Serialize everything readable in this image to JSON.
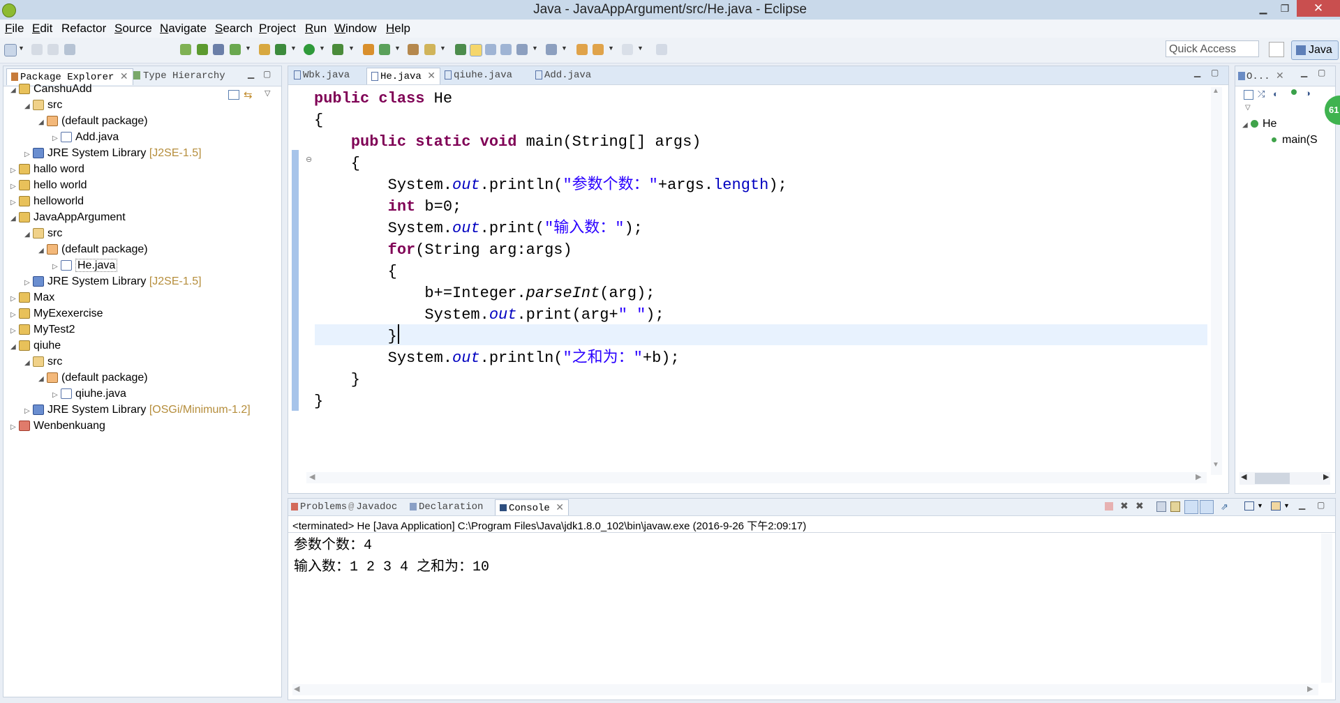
{
  "window": {
    "title": "Java - JavaAppArgument/src/He.java - Eclipse",
    "minimize": "▁",
    "maximize": "❐",
    "close": "✕"
  },
  "menu": [
    {
      "u": "F",
      "rest": "ile"
    },
    {
      "u": "E",
      "rest": "dit"
    },
    {
      "u": "",
      "rest": "Refactor"
    },
    {
      "u": "S",
      "rest": "ource"
    },
    {
      "u": "N",
      "rest": "avigate"
    },
    {
      "u": "S",
      "rest": "earch"
    },
    {
      "u": "P",
      "rest": "roject"
    },
    {
      "u": "R",
      "rest": "un"
    },
    {
      "u": "W",
      "rest": "indow"
    },
    {
      "u": "H",
      "rest": "elp"
    }
  ],
  "quick_access": {
    "placeholder": "Quick Access"
  },
  "perspective": {
    "label": "Java"
  },
  "package_explorer": {
    "tab_label": "Package Explorer",
    "tab2_label": "Type Hierarchy",
    "tree": [
      {
        "label": "CanshuAdd",
        "level": 0,
        "icon": "project-icon",
        "expanded": true
      },
      {
        "label": "src",
        "level": 1,
        "icon": "source-folder-icon",
        "expanded": true
      },
      {
        "label": "(default package)",
        "level": 2,
        "icon": "package-icon",
        "expanded": true
      },
      {
        "label": "Add.java",
        "level": 3,
        "icon": "java-file-icon",
        "expanded": false
      },
      {
        "label": "JRE System Library",
        "suffix": "[J2SE-1.5]",
        "level": 1,
        "icon": "jre-library-icon",
        "expanded": false
      },
      {
        "label": "hallo word",
        "level": 0,
        "icon": "project-icon",
        "expanded": false
      },
      {
        "label": "hello world",
        "level": 0,
        "icon": "project-icon",
        "expanded": false
      },
      {
        "label": "helloworld",
        "level": 0,
        "icon": "project-icon",
        "expanded": false
      },
      {
        "label": "JavaAppArgument",
        "level": 0,
        "icon": "project-icon",
        "expanded": true
      },
      {
        "label": "src",
        "level": 1,
        "icon": "source-folder-icon",
        "expanded": true
      },
      {
        "label": "(default package)",
        "level": 2,
        "icon": "package-icon",
        "expanded": true
      },
      {
        "label": "He.java",
        "level": 3,
        "icon": "java-file-icon",
        "expanded": false,
        "selected": true
      },
      {
        "label": "JRE System Library",
        "suffix": "[J2SE-1.5]",
        "level": 1,
        "icon": "jre-library-icon",
        "expanded": false
      },
      {
        "label": "Max",
        "level": 0,
        "icon": "project-icon",
        "expanded": false
      },
      {
        "label": "MyExexercise",
        "level": 0,
        "icon": "project-icon",
        "expanded": false
      },
      {
        "label": "MyTest2",
        "level": 0,
        "icon": "project-icon",
        "expanded": false
      },
      {
        "label": "qiuhe",
        "level": 0,
        "icon": "project-icon",
        "expanded": true
      },
      {
        "label": "src",
        "level": 1,
        "icon": "source-folder-icon",
        "expanded": true
      },
      {
        "label": "(default package)",
        "level": 2,
        "icon": "package-icon",
        "expanded": true
      },
      {
        "label": "qiuhe.java",
        "level": 3,
        "icon": "java-file-icon",
        "expanded": false
      },
      {
        "label": "JRE System Library",
        "suffix": "[OSGi/Minimum-1.2]",
        "level": 1,
        "icon": "jre-library-icon",
        "expanded": false
      },
      {
        "label": "Wenbenkuang",
        "level": 0,
        "icon": "project-error-icon",
        "expanded": false
      }
    ]
  },
  "editor": {
    "tabs": [
      "Wbk.java",
      "He.java",
      "qiuhe.java",
      "Add.java"
    ],
    "active_tab": "He.java"
  },
  "outline": {
    "tab_label": "O...",
    "class_label": "He",
    "method_label": "main(S",
    "badge": "61"
  },
  "console": {
    "tabs": [
      "Problems",
      "Javadoc",
      "Declaration",
      "Console"
    ],
    "active_tab": "Console",
    "status": "<terminated> He [Java Application] C:\\Program Files\\Java\\jdk1.8.0_102\\bin\\javaw.exe (2016-9-26 下午2:09:17)",
    "output": [
      "参数个数：4",
      "输入数：1 2 3 4 之和为：10"
    ]
  }
}
